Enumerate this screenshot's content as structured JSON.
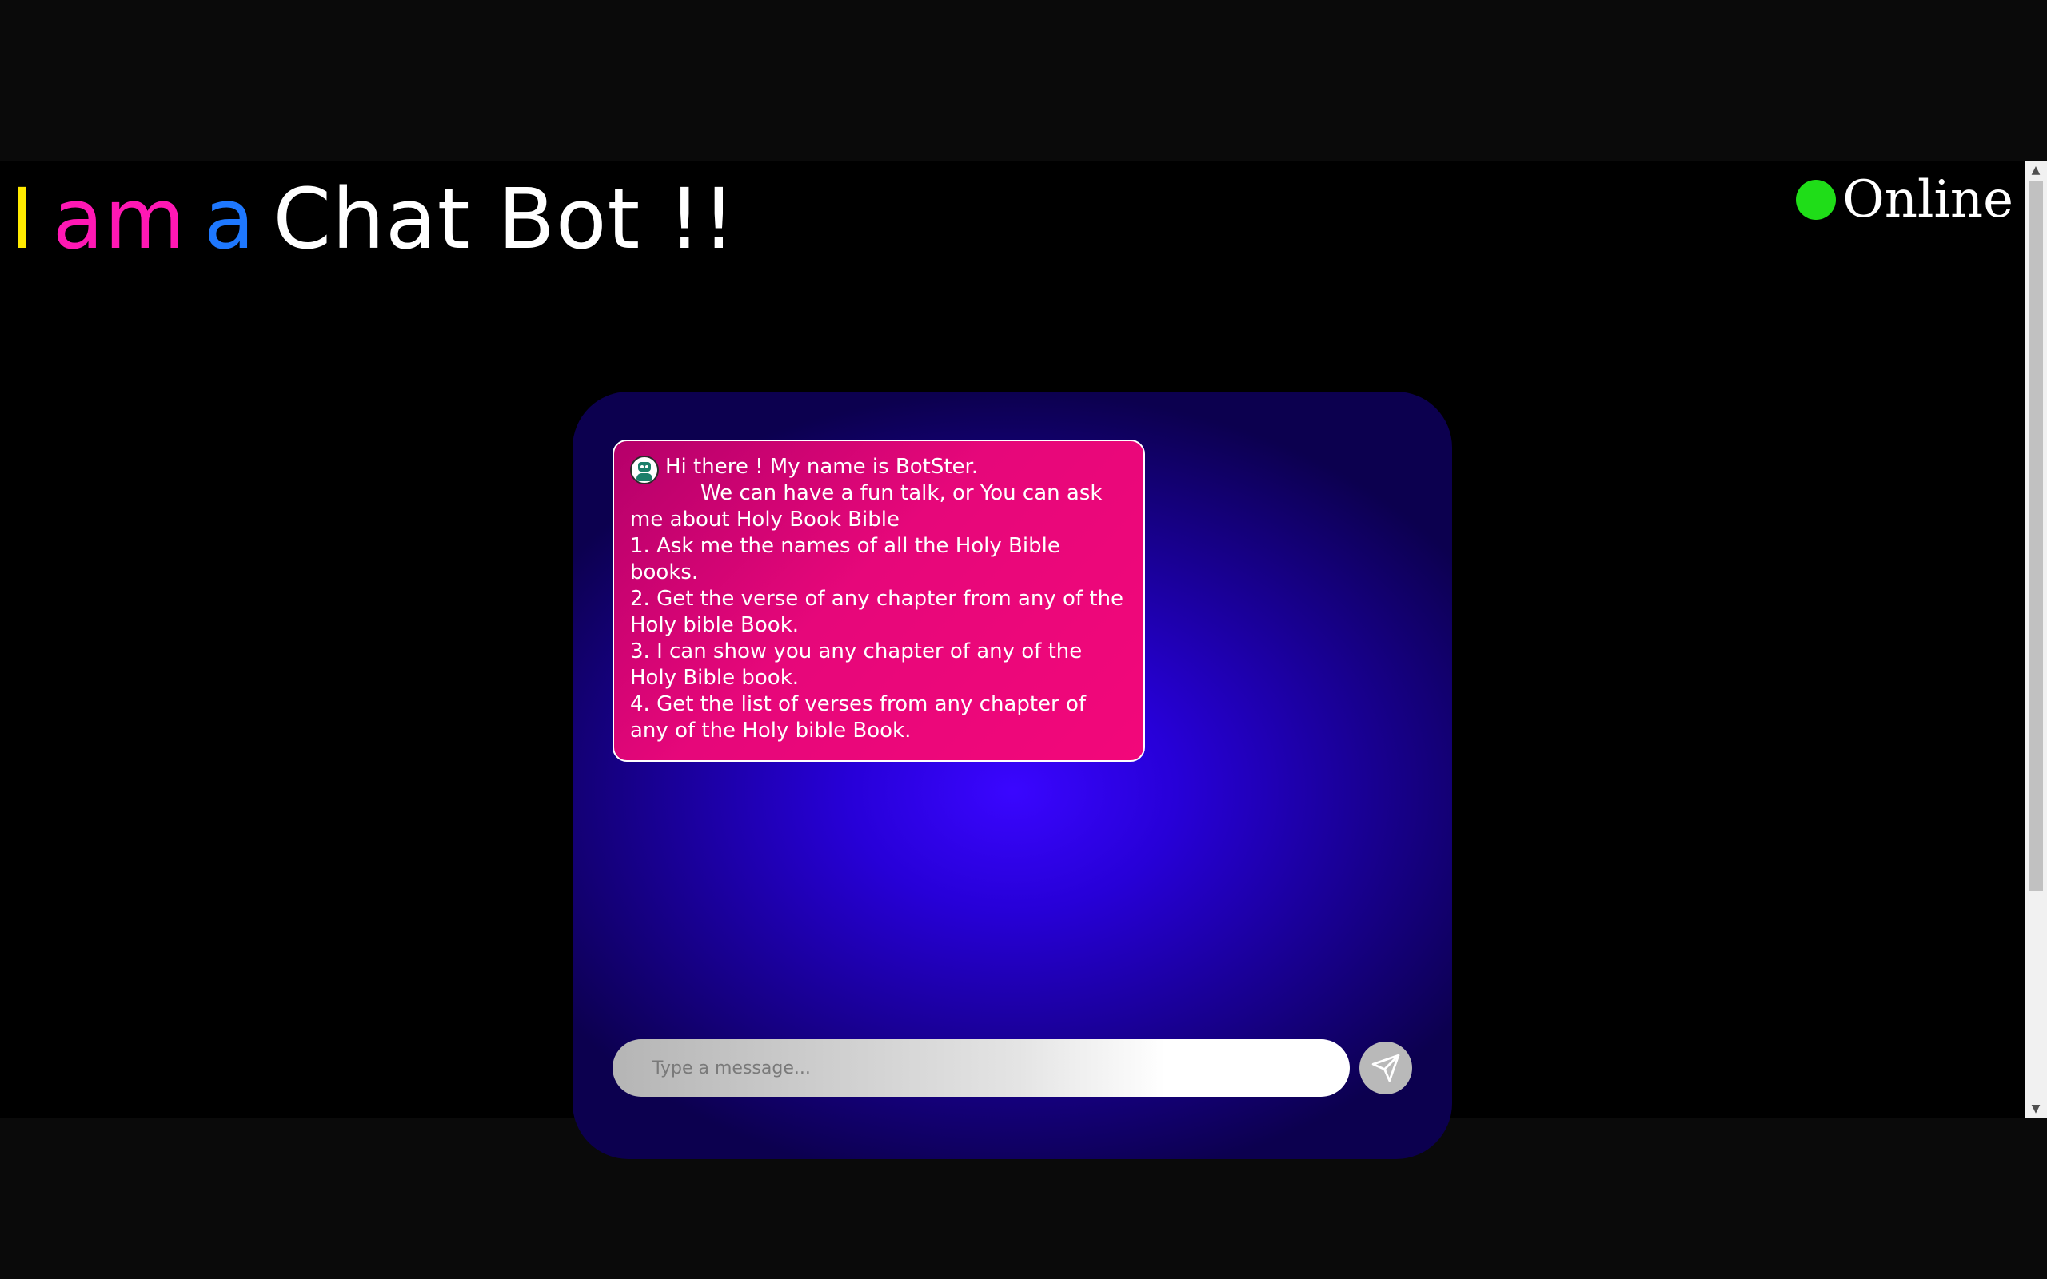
{
  "header": {
    "title_words": [
      {
        "text": "I",
        "color": "#ffea00"
      },
      {
        "text": "am",
        "color": "#ff18b4"
      },
      {
        "text": "a",
        "color": "#1e78ff"
      },
      {
        "text": "Chat Bot !!",
        "color": "#ffffff"
      }
    ]
  },
  "status": {
    "label": "Online",
    "indicator_color": "#1fdd18"
  },
  "chat": {
    "bot_message": {
      "avatar_icon": "robot-icon",
      "lines": [
        "Hi there ! My name is BotSter.",
        "We can have a fun talk, or You can ask me about Holy Book Bible",
        "1. Ask me the names of all the Holy Bible books.",
        "2. Get the verse of any chapter from any of the Holy bible Book.",
        "3. I can show you any chapter of any of the Holy Bible book.",
        "4. Get the list of verses from any chapter of any of the Holy bible Book."
      ]
    },
    "input": {
      "placeholder": "Type a message...",
      "value": ""
    },
    "send_button_icon": "send-icon"
  },
  "colors": {
    "message_bubble": "#e6077a",
    "panel_glow": "#3a06ff"
  }
}
